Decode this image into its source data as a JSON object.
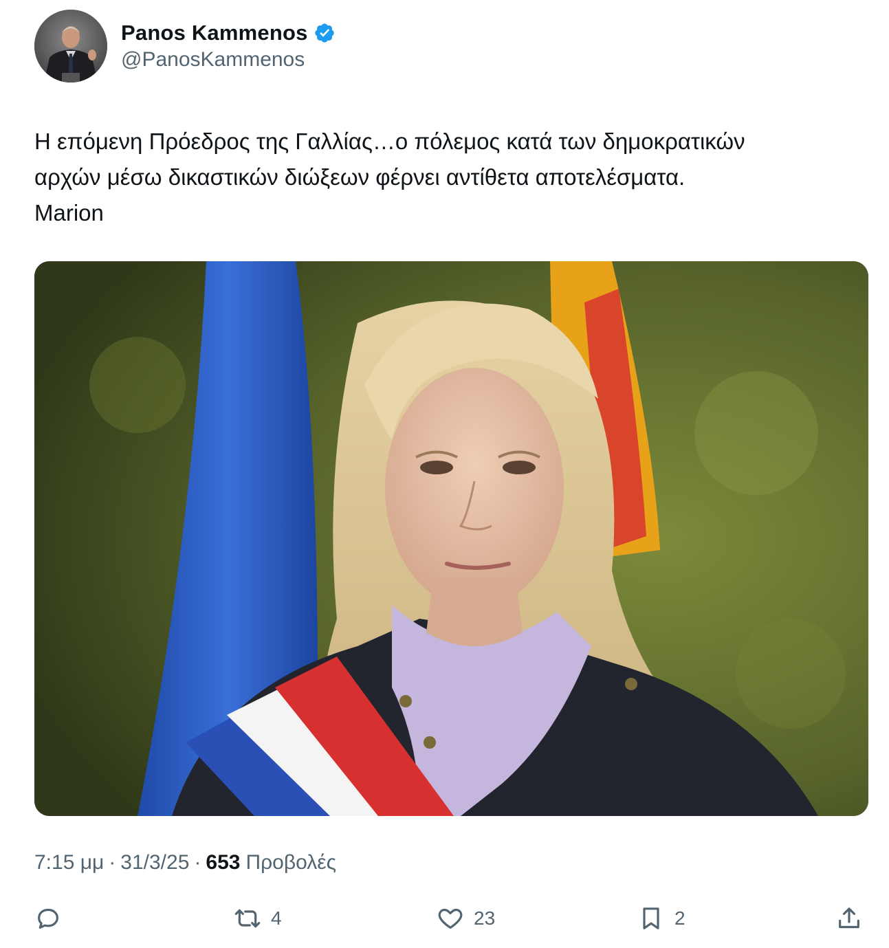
{
  "author": {
    "display_name": "Panos Kammenos",
    "handle": "@PanosKammenos",
    "verified": true,
    "verified_color": "#1d9bf0"
  },
  "tweet": {
    "lines": [
      "Η επόμενη Πρόεδρος της Γαλλίας…ο πόλεμος κατά των δημοκρατικών",
      "αρχών μέσω δικαστικών διώξεων φέρνει αντίθετα αποτελέσματα.",
      "Marion"
    ]
  },
  "meta": {
    "time": "7:15 μμ",
    "separator": "·",
    "date": "31/3/25",
    "views_count": "653",
    "views_label": "Προβολές"
  },
  "actions": {
    "reply": {
      "icon": "reply-icon",
      "count": ""
    },
    "retweet": {
      "icon": "retweet-icon",
      "count": "4"
    },
    "like": {
      "icon": "heart-icon",
      "count": "23"
    },
    "bookmark": {
      "icon": "bookmark-icon",
      "count": "2"
    },
    "share": {
      "icon": "share-icon",
      "count": ""
    }
  },
  "colors": {
    "text": "#0f1419",
    "secondary": "#536471",
    "accent": "#1d9bf0"
  }
}
